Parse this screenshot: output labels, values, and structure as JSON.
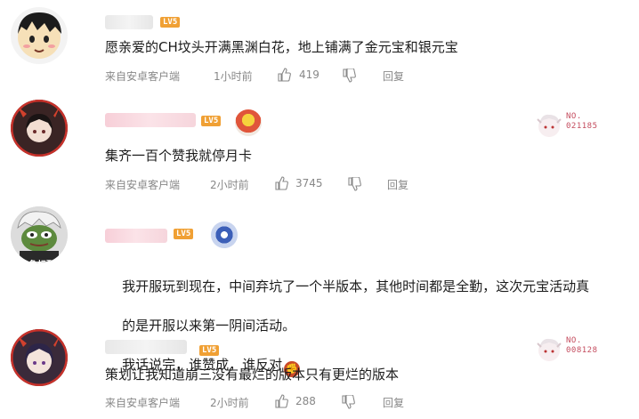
{
  "comments": [
    {
      "level": "LV5",
      "text": "愿亲爱的CH坟头开满黑渊白花，地上铺满了金元宝和银元宝",
      "source": "来自安卓客户端",
      "time": "1小时前",
      "likes": "419",
      "reply": "回复"
    },
    {
      "level": "LV5",
      "text": "集齐一百个赞我就停月卡",
      "source": "来自安卓客户端",
      "time": "2小时前",
      "likes": "3745",
      "reply": "回复",
      "fan_badge": {
        "label": "NO.",
        "number": "021185"
      }
    },
    {
      "level": "LV5",
      "text_line1": "我开服玩到现在，中间弃坑了一个半版本，其他时间都是全勤，这次元宝活动真",
      "text_line2": "的是开服以来第一阴间活动。",
      "text_line3": "我话说完，谁赞成，谁反对",
      "avatar_caption": "主角标配"
    },
    {
      "level": "LV5",
      "text": "策划让我知道崩三没有最烂的版本只有更烂的版本",
      "source": "来自安卓客户端",
      "time": "2小时前",
      "likes": "288",
      "reply": "回复",
      "fan_badge": {
        "label": "NO.",
        "number": "008128"
      }
    }
  ],
  "colors": {
    "level_badge": "#f0a034",
    "fan_number": "#c44c5e",
    "meta_text": "#888888"
  }
}
